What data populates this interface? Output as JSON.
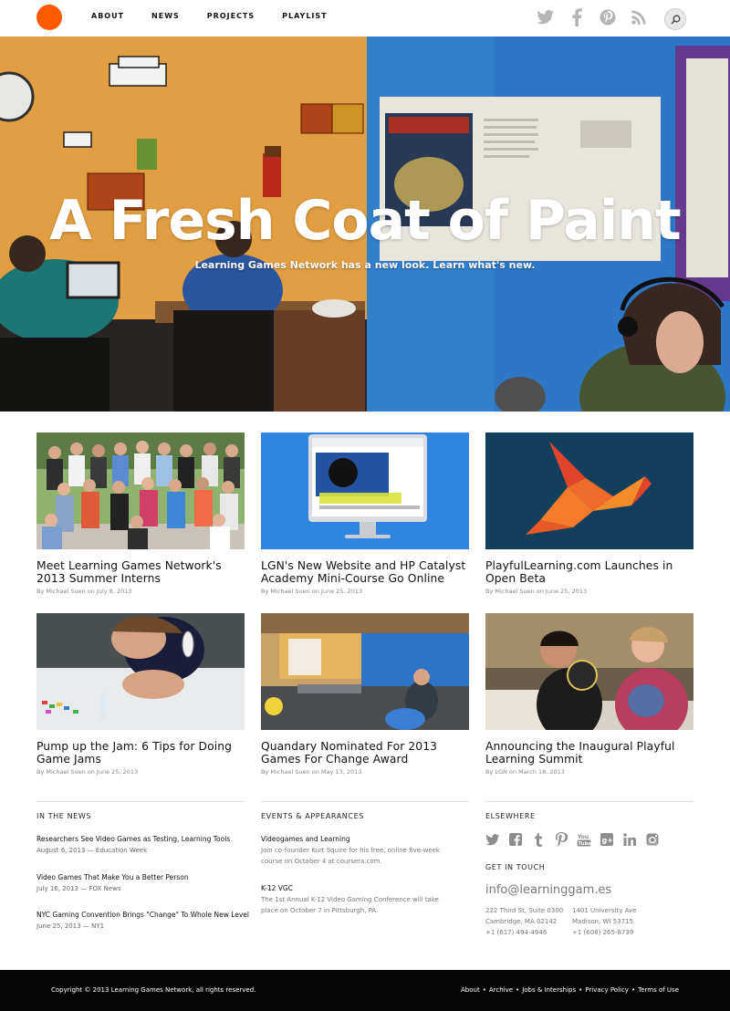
{
  "nav": {
    "about": "ABOUT",
    "news": "NEWS",
    "projects": "PROJECTS",
    "playlist": "PLAYLIST"
  },
  "social_top": [
    "twitter-icon",
    "facebook-icon",
    "pinterest-icon",
    "rss-icon"
  ],
  "hero": {
    "title": "A Fresh Coat of Paint",
    "subtitle": "Learning Games Network has a new look. Learn what's new."
  },
  "posts": [
    {
      "title": "Meet Learning Games Network's 2013 Summer Interns",
      "meta": "By Michael Suen on July 8, 2013"
    },
    {
      "title": "LGN's New Website and HP Catalyst Academy Mini-Course Go Online",
      "meta": "By Michael Suen on June 25, 2013"
    },
    {
      "title": "PlayfulLearning.com Launches in Open Beta",
      "meta": "By Michael Suen on June 25, 2013"
    },
    {
      "title": "Pump up the Jam: 6 Tips for Doing Game Jams",
      "meta": "By Michael Suen on June 25, 2013"
    },
    {
      "title": "Quandary Nominated For 2013 Games For Change Award",
      "meta": "By Michael Suen on May 13, 2013"
    },
    {
      "title": "Announcing the Inaugural Playful Learning Summit",
      "meta": "By LGN on March 18, 2013"
    }
  ],
  "in_the_news": {
    "heading": "IN THE NEWS",
    "items": [
      {
        "title": "Researchers See Video Games as Testing, Learning Tools",
        "meta": "August 6, 2013 — Education Week"
      },
      {
        "title": "Video Games That Make You a Better Person",
        "meta": "July 16, 2013 — FOX News"
      },
      {
        "title": "NYC Gaming Convention Brings \"Change\" To Whole New Level",
        "meta": "June 25, 2013 — NY1"
      }
    ]
  },
  "events": {
    "heading": "EVENTS & APPEARANCES",
    "items": [
      {
        "title": "Videogames and Learning",
        "desc": "Join co-founder Kurt Squire for his free, online five-week course on October 4 at coursera.com."
      },
      {
        "title": "K-12 VGC",
        "desc": "The 1st Annual K-12 Video Gaming Conference will take place on October 7 in Pittsburgh, PA."
      }
    ]
  },
  "elsewhere": {
    "heading": "ELSEWHERE",
    "icons": [
      "twitter-icon",
      "facebook-icon",
      "tumblr-icon",
      "pinterest-icon",
      "youtube-icon",
      "googleplus-icon",
      "linkedin-icon",
      "instagram-icon"
    ]
  },
  "contact": {
    "heading": "GET IN TOUCH",
    "email": "info@learninggam.es",
    "address1": [
      "222 Third St, Suite 0300",
      "Cambridge, MA 02142",
      "+1 (617) 494-4946"
    ],
    "address2": [
      "1401 University Ave",
      "Madison, WI 53715",
      "+1 (608) 265-8739"
    ]
  },
  "footer": {
    "copyright": "Copyright © 2013 Learning Games Network, all rights reserved.",
    "links": [
      "About",
      "Archive",
      "Jobs & Interships",
      "Privacy Policy",
      "Terms of Use"
    ]
  },
  "colors": {
    "brand_orange": "#ff5a00",
    "footer_bg": "#050505",
    "icon_gray": "#b5b5b5"
  }
}
